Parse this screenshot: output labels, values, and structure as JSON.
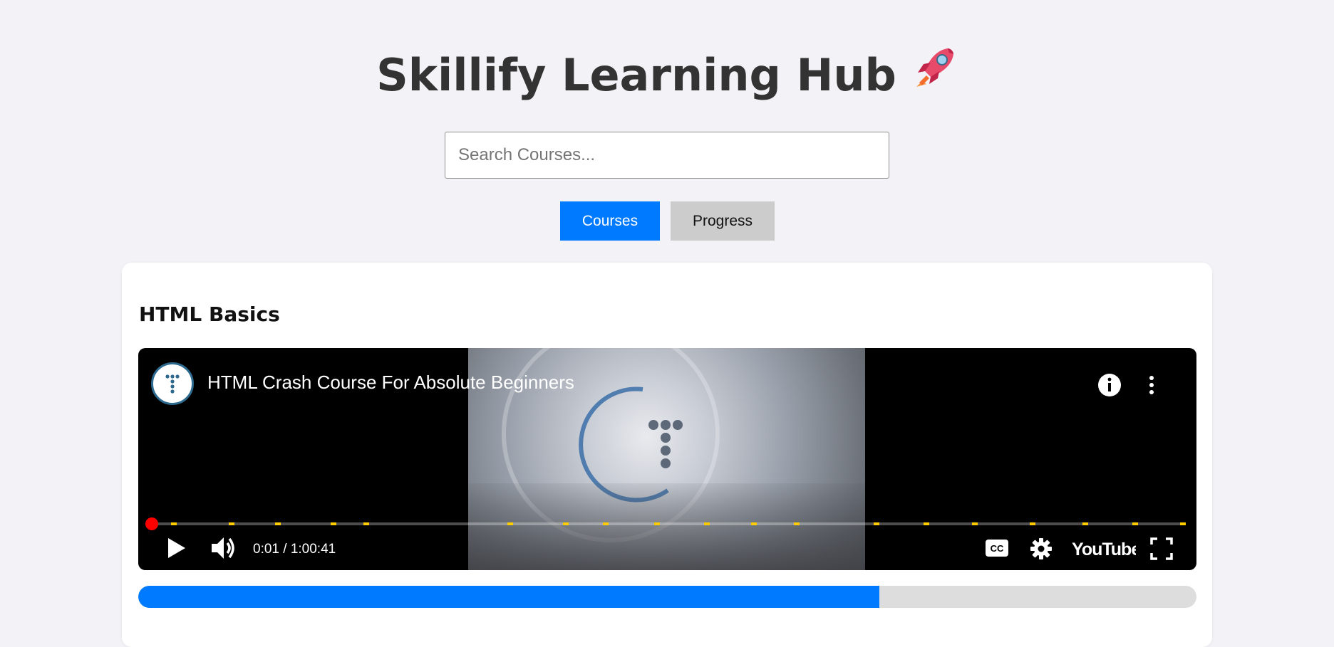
{
  "header": {
    "title": "Skillify Learning Hub",
    "emoji": "🚀"
  },
  "search": {
    "placeholder": "Search Courses...",
    "value": ""
  },
  "tabs": [
    {
      "label": "Courses",
      "active": true
    },
    {
      "label": "Progress",
      "active": false
    }
  ],
  "course": {
    "title": "HTML Basics",
    "video": {
      "title": "HTML Crash Course For Absolute Beginners",
      "time": "0:01 / 1:00:41",
      "brand": "YouTube",
      "chapter_markers": 22
    },
    "progress_percent": 70
  },
  "colors": {
    "accent": "#007bff",
    "inactive_tab": "#cccccc",
    "background": "#f3f3f7",
    "scrub": "#ff0000",
    "chapter_marker": "#ffcc00"
  },
  "icons": [
    "rocket-icon",
    "channel-logo-icon",
    "info-icon",
    "more-vert-icon",
    "play-icon",
    "volume-icon",
    "cc-icon",
    "settings-gear-icon",
    "youtube-logo-icon",
    "fullscreen-icon"
  ]
}
